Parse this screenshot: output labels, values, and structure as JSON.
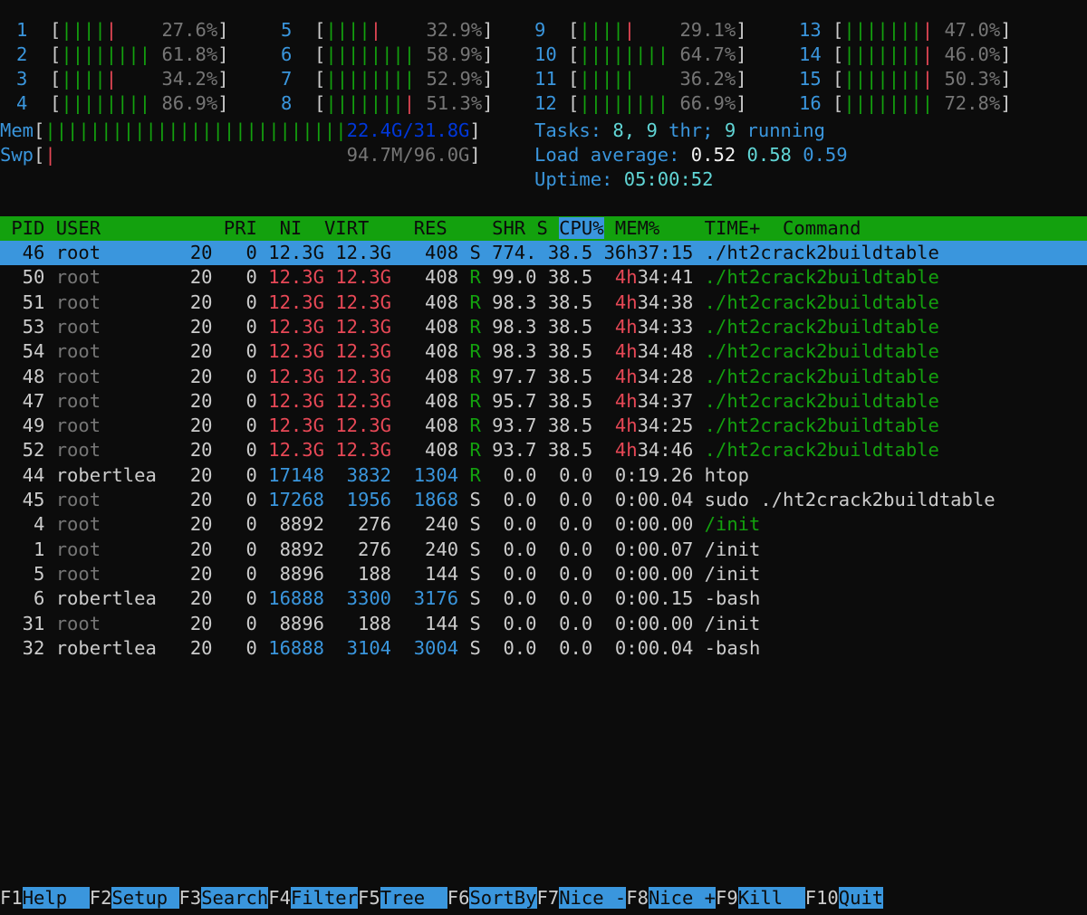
{
  "meters": {
    "cpus": [
      {
        "id": "1",
        "bar": "||||",
        "bar_tail": "|",
        "pct": "27.6%"
      },
      {
        "id": "2",
        "bar": "||||||||",
        "bar_tail": "",
        "pct": "61.8%"
      },
      {
        "id": "3",
        "bar": "||||",
        "bar_tail": "|",
        "pct": "34.2%"
      },
      {
        "id": "4",
        "bar": "||||||||",
        "bar_tail": "",
        "pct": "86.9%"
      },
      {
        "id": "5",
        "bar": "||||",
        "bar_tail": "|",
        "pct": "32.9%"
      },
      {
        "id": "6",
        "bar": "||||||||",
        "bar_tail": "",
        "pct": "58.9%"
      },
      {
        "id": "7",
        "bar": "||||||||",
        "bar_tail": "",
        "pct": "52.9%"
      },
      {
        "id": "8",
        "bar": "|||||||",
        "bar_tail": "|",
        "pct": "51.3%"
      },
      {
        "id": "9",
        "bar": "||||",
        "bar_tail": "|",
        "pct": "29.1%"
      },
      {
        "id": "10",
        "bar": "||||||||",
        "bar_tail": "",
        "pct": "64.7%"
      },
      {
        "id": "11",
        "bar": "|||||",
        "bar_tail": "",
        "pct": "36.2%"
      },
      {
        "id": "12",
        "bar": "||||||||",
        "bar_tail": "",
        "pct": "66.9%"
      },
      {
        "id": "13",
        "bar": "|||||||",
        "bar_tail": "|",
        "pct": "47.0%"
      },
      {
        "id": "14",
        "bar": "|||||||",
        "bar_tail": "|",
        "pct": "46.0%"
      },
      {
        "id": "15",
        "bar": "|||||||",
        "bar_tail": "|",
        "pct": "50.3%"
      },
      {
        "id": "16",
        "bar": "||||||||",
        "bar_tail": "",
        "pct": "72.8%"
      }
    ],
    "mem": {
      "label": "Mem",
      "bar": "|||||||||||||||||||||||||||",
      "value": "22.4G/31.8G"
    },
    "swp": {
      "label": "Swp",
      "bar": "|",
      "value": "94.7M/96.0G"
    }
  },
  "tasks": {
    "label": "Tasks:",
    "tasks": "8,",
    "thr": "9",
    "thr_label": "thr;",
    "running": "9",
    "running_label": "running"
  },
  "load": {
    "label": "Load average:",
    "l1": "0.52",
    "l5": "0.58",
    "l15": "0.59"
  },
  "uptime": {
    "label": "Uptime:",
    "value": "05:00:52"
  },
  "header": {
    "pid": "PID",
    "user": "USER",
    "pri": "PRI",
    "ni": "NI",
    "virt": "VIRT",
    "res": "RES",
    "shr": "SHR",
    "s": "S",
    "cpu": "CPU%",
    "mem": "MEM%",
    "time": "TIME+",
    "command": "Command"
  },
  "processes": [
    {
      "pid": "46",
      "user": "root",
      "pri": "20",
      "ni": "0",
      "virt": "12.3G",
      "res": "12.3G",
      "shr": "408",
      "s": "S",
      "cpu": "774.",
      "mem": "38.5",
      "time": "36h37:15",
      "command": "./ht2crack2buildtable"
    },
    {
      "pid": "50",
      "user": "root",
      "pri": "20",
      "ni": "0",
      "virt": "12.3G",
      "res": "12.3G",
      "shr": "408",
      "s": "R",
      "cpu": "99.0",
      "mem": "38.5",
      "time": "4h34:41",
      "command": "./ht2crack2buildtable"
    },
    {
      "pid": "51",
      "user": "root",
      "pri": "20",
      "ni": "0",
      "virt": "12.3G",
      "res": "12.3G",
      "shr": "408",
      "s": "R",
      "cpu": "98.3",
      "mem": "38.5",
      "time": "4h34:38",
      "command": "./ht2crack2buildtable"
    },
    {
      "pid": "53",
      "user": "root",
      "pri": "20",
      "ni": "0",
      "virt": "12.3G",
      "res": "12.3G",
      "shr": "408",
      "s": "R",
      "cpu": "98.3",
      "mem": "38.5",
      "time": "4h34:33",
      "command": "./ht2crack2buildtable"
    },
    {
      "pid": "54",
      "user": "root",
      "pri": "20",
      "ni": "0",
      "virt": "12.3G",
      "res": "12.3G",
      "shr": "408",
      "s": "R",
      "cpu": "98.3",
      "mem": "38.5",
      "time": "4h34:48",
      "command": "./ht2crack2buildtable"
    },
    {
      "pid": "48",
      "user": "root",
      "pri": "20",
      "ni": "0",
      "virt": "12.3G",
      "res": "12.3G",
      "shr": "408",
      "s": "R",
      "cpu": "97.7",
      "mem": "38.5",
      "time": "4h34:28",
      "command": "./ht2crack2buildtable"
    },
    {
      "pid": "47",
      "user": "root",
      "pri": "20",
      "ni": "0",
      "virt": "12.3G",
      "res": "12.3G",
      "shr": "408",
      "s": "R",
      "cpu": "95.7",
      "mem": "38.5",
      "time": "4h34:37",
      "command": "./ht2crack2buildtable"
    },
    {
      "pid": "49",
      "user": "root",
      "pri": "20",
      "ni": "0",
      "virt": "12.3G",
      "res": "12.3G",
      "shr": "408",
      "s": "R",
      "cpu": "93.7",
      "mem": "38.5",
      "time": "4h34:25",
      "command": "./ht2crack2buildtable"
    },
    {
      "pid": "52",
      "user": "root",
      "pri": "20",
      "ni": "0",
      "virt": "12.3G",
      "res": "12.3G",
      "shr": "408",
      "s": "R",
      "cpu": "93.7",
      "mem": "38.5",
      "time": "4h34:46",
      "command": "./ht2crack2buildtable"
    },
    {
      "pid": "44",
      "user": "robertlea",
      "pri": "20",
      "ni": "0",
      "virt": "17148",
      "res": "3832",
      "shr": "1304",
      "s": "R",
      "cpu": "0.0",
      "mem": "0.0",
      "time": "0:19.26",
      "command": "htop"
    },
    {
      "pid": "45",
      "user": "root",
      "pri": "20",
      "ni": "0",
      "virt": "17268",
      "res": "1956",
      "shr": "1868",
      "s": "S",
      "cpu": "0.0",
      "mem": "0.0",
      "time": "0:00.04",
      "command": "sudo ./ht2crack2buildtable"
    },
    {
      "pid": "4",
      "user": "root",
      "pri": "20",
      "ni": "0",
      "virt": "8892",
      "res": "276",
      "shr": "240",
      "s": "S",
      "cpu": "0.0",
      "mem": "0.0",
      "time": "0:00.00",
      "command": "/init"
    },
    {
      "pid": "1",
      "user": "root",
      "pri": "20",
      "ni": "0",
      "virt": "8892",
      "res": "276",
      "shr": "240",
      "s": "S",
      "cpu": "0.0",
      "mem": "0.0",
      "time": "0:00.07",
      "command": "/init"
    },
    {
      "pid": "5",
      "user": "root",
      "pri": "20",
      "ni": "0",
      "virt": "8896",
      "res": "188",
      "shr": "144",
      "s": "S",
      "cpu": "0.0",
      "mem": "0.0",
      "time": "0:00.00",
      "command": "/init"
    },
    {
      "pid": "6",
      "user": "robertlea",
      "pri": "20",
      "ni": "0",
      "virt": "16888",
      "res": "3300",
      "shr": "3176",
      "s": "S",
      "cpu": "0.0",
      "mem": "0.0",
      "time": "0:00.15",
      "command": "-bash"
    },
    {
      "pid": "31",
      "user": "root",
      "pri": "20",
      "ni": "0",
      "virt": "8896",
      "res": "188",
      "shr": "144",
      "s": "S",
      "cpu": "0.0",
      "mem": "0.0",
      "time": "0:00.00",
      "command": "/init"
    },
    {
      "pid": "32",
      "user": "robertlea",
      "pri": "20",
      "ni": "0",
      "virt": "16888",
      "res": "3104",
      "shr": "3004",
      "s": "S",
      "cpu": "0.0",
      "mem": "0.0",
      "time": "0:00.04",
      "command": "-bash"
    }
  ],
  "footer": [
    {
      "key": "F1",
      "label": "Help  "
    },
    {
      "key": "F2",
      "label": "Setup "
    },
    {
      "key": "F3",
      "label": "Search"
    },
    {
      "key": "F4",
      "label": "Filter"
    },
    {
      "key": "F5",
      "label": "Tree  "
    },
    {
      "key": "F6",
      "label": "SortBy"
    },
    {
      "key": "F7",
      "label": "Nice -"
    },
    {
      "key": "F8",
      "label": "Nice +"
    },
    {
      "key": "F9",
      "label": "Kill  "
    },
    {
      "key": "F10",
      "label": "Quit"
    }
  ]
}
